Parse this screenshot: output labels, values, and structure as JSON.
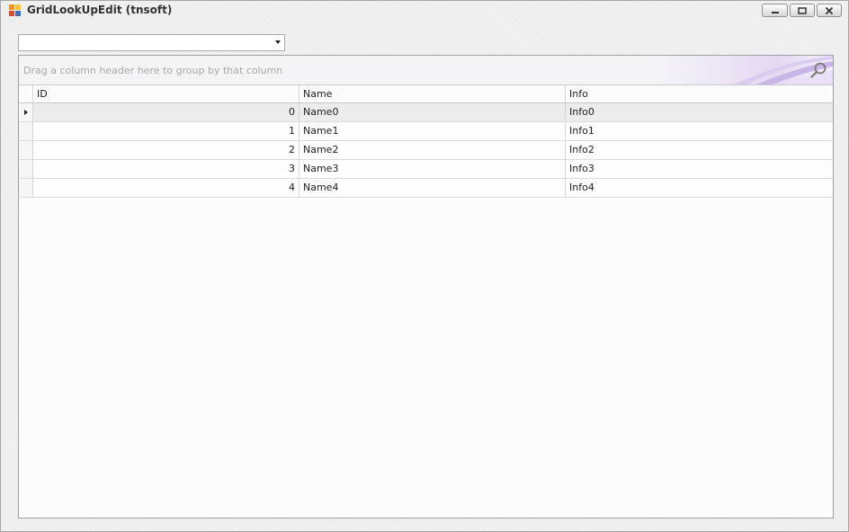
{
  "window": {
    "title": "GridLookUpEdit (tnsoft)",
    "colors": {
      "icon_orange": "#f7941d",
      "icon_red": "#e04b2a",
      "icon_blue": "#3b6fc7",
      "icon_yellow": "#f9c623"
    }
  },
  "combo": {
    "value": "",
    "icon": "chevron-down-icon"
  },
  "grid": {
    "group_panel_text": "Drag a column header here to group by that column",
    "find_icon": "search-icon",
    "columns": [
      "ID",
      "Name",
      "Info"
    ],
    "rows": [
      {
        "id": "0",
        "name": "Name0",
        "info": "Info0"
      },
      {
        "id": "1",
        "name": "Name1",
        "info": "Info1"
      },
      {
        "id": "2",
        "name": "Name2",
        "info": "Info2"
      },
      {
        "id": "3",
        "name": "Name3",
        "info": "Info3"
      },
      {
        "id": "4",
        "name": "Name4",
        "info": "Info4"
      }
    ],
    "focused_row": 0
  }
}
